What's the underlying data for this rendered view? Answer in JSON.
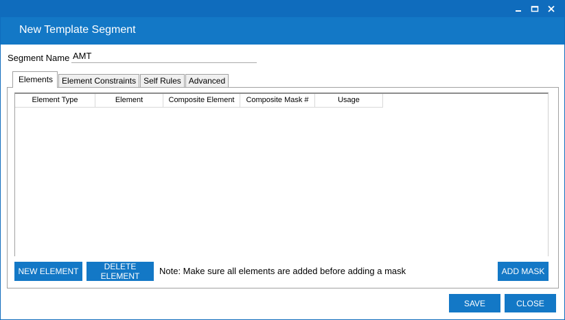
{
  "window": {
    "title": "New Template Segment",
    "controls": [
      "minimize-icon",
      "maximize-icon",
      "close-icon"
    ]
  },
  "segment": {
    "label": "Segment Name",
    "value": "AMT"
  },
  "tabs": [
    {
      "label": "Elements",
      "active": true
    },
    {
      "label": "Element Constraints",
      "active": false
    },
    {
      "label": "Self Rules",
      "active": false
    },
    {
      "label": "Advanced",
      "active": false
    }
  ],
  "grid": {
    "columns": [
      "Element Type",
      "Element",
      "Composite Element",
      "Composite Mask #",
      "Usage"
    ],
    "rows": []
  },
  "actions": {
    "new_element": "NEW ELEMENT",
    "delete_element": "DELETE ELEMENT",
    "note": "Note: Make sure all elements are added before adding a mask",
    "add_mask": "ADD MASK"
  },
  "footer": {
    "save": "SAVE",
    "close": "CLOSE"
  },
  "colors": {
    "accent": "#1378c6",
    "titlebar_top": "#0f6cbd"
  }
}
